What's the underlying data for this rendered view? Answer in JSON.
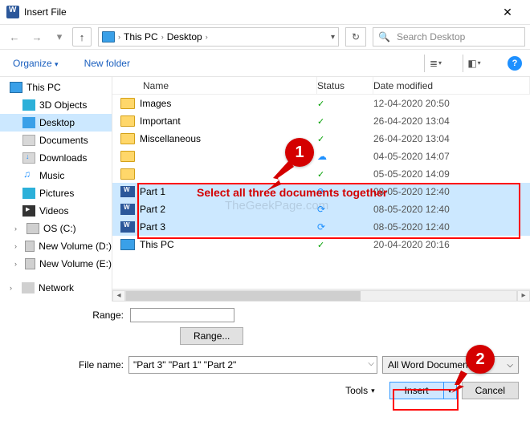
{
  "window": {
    "title": "Insert File",
    "close_glyph": "✕"
  },
  "nav": {
    "back": "←",
    "fwd": "→",
    "dd": "▾",
    "up": "↑",
    "refresh": "↻"
  },
  "breadcrumb": {
    "sep": "›",
    "items": [
      "This PC",
      "Desktop"
    ]
  },
  "search": {
    "placeholder": "Search Desktop",
    "icon": "🔍"
  },
  "subbar": {
    "organize": "Organize",
    "organize_dd": "▾",
    "newfolder": "New folder",
    "help": "?"
  },
  "nav_tree": {
    "top": "This PC",
    "items": [
      {
        "icon": "cube",
        "label": "3D Objects"
      },
      {
        "icon": "desk",
        "label": "Desktop",
        "selected": true
      },
      {
        "icon": "doc",
        "label": "Documents"
      },
      {
        "icon": "dl",
        "label": "Downloads"
      },
      {
        "icon": "mus",
        "label": "Music"
      },
      {
        "icon": "pic",
        "label": "Pictures"
      },
      {
        "icon": "vid",
        "label": "Videos"
      },
      {
        "icon": "drv",
        "label": "OS (C:)",
        "exp": "›"
      },
      {
        "icon": "drv",
        "label": "New Volume (D:)",
        "exp": "›"
      },
      {
        "icon": "drv",
        "label": "New Volume (E:)",
        "exp": "›"
      }
    ],
    "network": "Network"
  },
  "columns": {
    "name": "Name",
    "status": "Status",
    "date": "Date modified"
  },
  "rows": [
    {
      "icon": "folder",
      "name": "Images",
      "status": "check",
      "date": "12-04-2020 20:50"
    },
    {
      "icon": "folder",
      "name": "Important",
      "status": "check",
      "date": "26-04-2020 13:04"
    },
    {
      "icon": "folder",
      "name": "Miscellaneous",
      "status": "check",
      "date": "26-04-2020 13:04"
    },
    {
      "icon": "folder",
      "name": "",
      "status": "cloud",
      "date": "04-05-2020 14:07"
    },
    {
      "icon": "folder",
      "name": "",
      "status": "check",
      "date": "05-05-2020 14:09"
    },
    {
      "icon": "word",
      "name": "Part 1",
      "status": "sync",
      "date": "08-05-2020 12:40",
      "sel": true
    },
    {
      "icon": "word",
      "name": "Part 2",
      "status": "sync",
      "date": "08-05-2020 12:40",
      "sel": true
    },
    {
      "icon": "word",
      "name": "Part 3",
      "status": "sync",
      "date": "08-05-2020 12:40",
      "sel": true
    },
    {
      "icon": "pc",
      "name": "This PC",
      "status": "check",
      "date": "20-04-2020 20:16"
    }
  ],
  "bottom": {
    "range_label": "Range:",
    "range_value": "",
    "range_btn": "Range...",
    "filename_label": "File name:",
    "filename_value": "\"Part 3\" \"Part 1\" \"Part 2\"",
    "filter_label": "All Word Documents",
    "tools_label": "Tools",
    "tools_dd": "▾",
    "insert": "Insert",
    "insert_dd": "▾",
    "cancel": "Cancel"
  },
  "annotations": {
    "one": "1",
    "two": "2",
    "text1": "Select all three documents together",
    "watermark": "TheGeekPage.com"
  }
}
